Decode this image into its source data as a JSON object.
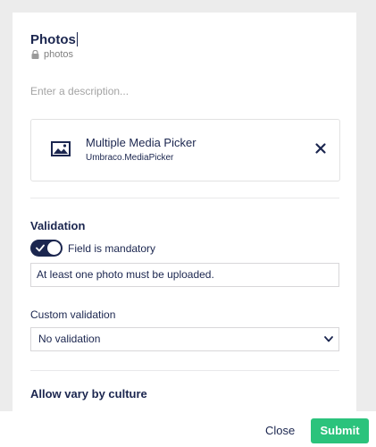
{
  "property": {
    "name": "Photos",
    "alias": "photos",
    "description_placeholder": "Enter a description..."
  },
  "editor": {
    "name": "Multiple Media Picker",
    "alias": "Umbraco.MediaPicker",
    "icon": "picture-icon"
  },
  "validation": {
    "heading": "Validation",
    "mandatory_label": "Field is mandatory",
    "mandatory_checked": true,
    "mandatory_message": "At least one photo must be uploaded.",
    "custom_label": "Custom validation",
    "custom_value": "No validation"
  },
  "culture": {
    "heading": "Allow vary by culture",
    "enabled": false
  },
  "footer": {
    "close_label": "Close",
    "submit_label": "Submit"
  },
  "colors": {
    "primary": "#1b264f",
    "submit": "#2bc37c",
    "muted": "#a4a4a4"
  }
}
